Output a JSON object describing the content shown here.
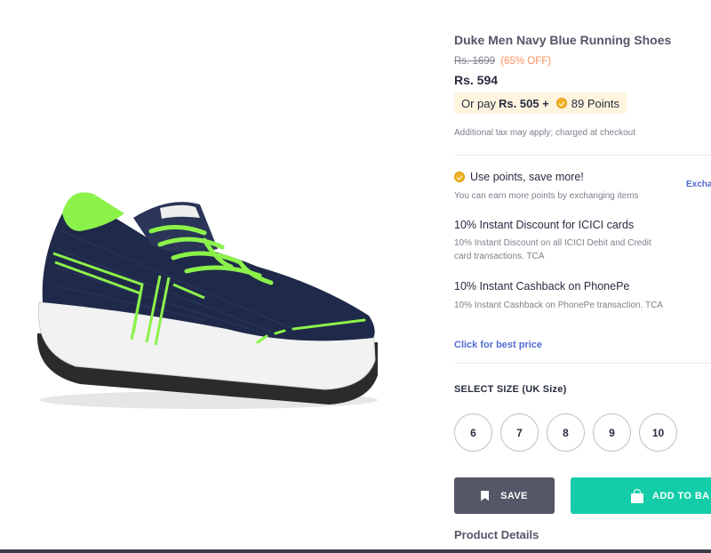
{
  "product": {
    "title": "Duke Men Navy Blue Running Shoes",
    "mrp": "Rs. 1699",
    "discount": "(65% OFF)",
    "price": "Rs. 594",
    "points_offer": {
      "prefix": "Or pay",
      "cash": "Rs. 505 +",
      "points": "89 Points"
    },
    "tax_note": "Additional tax may apply; charged at checkout"
  },
  "offers": [
    {
      "title": "Use points, save more!",
      "desc": "You can earn more points by exchanging items"
    },
    {
      "title": "10% Instant Discount for ICICI cards",
      "desc": "10% Instant Discount on all ICICI Debit and Credit card transactions. TCA"
    },
    {
      "title": "10% Instant Cashback on PhonePe",
      "desc": "10% Instant Cashback on PhonePe transaction. TCA"
    }
  ],
  "exchange_link": "Excha",
  "best_price_link": "Click for best price",
  "size_section": {
    "title": "SELECT SIZE (UK Size)",
    "sizes": [
      "6",
      "7",
      "8",
      "9",
      "10"
    ]
  },
  "actions": {
    "save": "SAVE",
    "add_to_bag": "ADD TO BA"
  },
  "details_title": "Product Details",
  "colors": {
    "accent_green": "#14cda8",
    "save_grey": "#535766",
    "discount_orange": "#ff905a",
    "link_blue": "#526cd0",
    "coin_gold": "#f0b323",
    "shoe_navy": "#1f2a4a",
    "shoe_neon": "#8cf24a"
  }
}
